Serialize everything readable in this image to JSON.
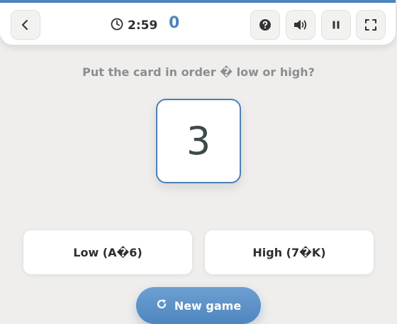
{
  "header": {
    "timer": "2:59",
    "score": "0",
    "icons": {
      "back": "chevron-left-icon",
      "clock": "clock-icon",
      "help": "question-icon",
      "sound": "speaker-icon",
      "pause": "pause-icon",
      "fullscreen": "fullscreen-icon"
    }
  },
  "game": {
    "question": "Put the card in order � low or high?",
    "card_value": "3",
    "low_label": "Low (A�6)",
    "high_label": "High (7�K)",
    "new_game_label": "New game"
  },
  "colors": {
    "accent": "#4f83bd",
    "background": "#efeeec",
    "text": "#2e2e2e",
    "muted": "#8a8e8e"
  }
}
